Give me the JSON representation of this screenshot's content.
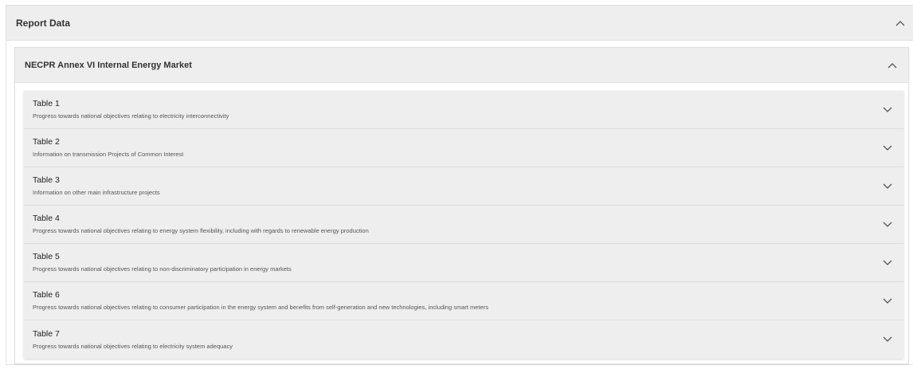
{
  "report": {
    "title": "Report Data"
  },
  "section": {
    "title": "NECPR Annex VI Internal Energy Market"
  },
  "tables": [
    {
      "title": "Table 1",
      "description": "Progress towards national objectives relating to electricity interconnectivity"
    },
    {
      "title": "Table 2",
      "description": "Information on transmission Projects of Common Interest"
    },
    {
      "title": "Table 3",
      "description": "Information on other main infrastructure projects"
    },
    {
      "title": "Table 4",
      "description": "Progress towards national objectives relating to energy system flexibility, including with regards to renewable energy production"
    },
    {
      "title": "Table 5",
      "description": "Progress towards national objectives relating to non-discriminatory participation in energy markets"
    },
    {
      "title": "Table 6",
      "description": "Progress towards national objectives relating to consumer participation in the energy system and benefits from self-generation and new technologies, including smart meters"
    },
    {
      "title": "Table 7",
      "description": "Progress towards national objectives relating to electricity system adequacy"
    }
  ],
  "icons": {
    "expanded": "chevron-up-icon",
    "collapsed": "chevron-down-icon"
  },
  "colors": {
    "header_bg": "#eeeeee",
    "border": "#e0e0e0"
  }
}
